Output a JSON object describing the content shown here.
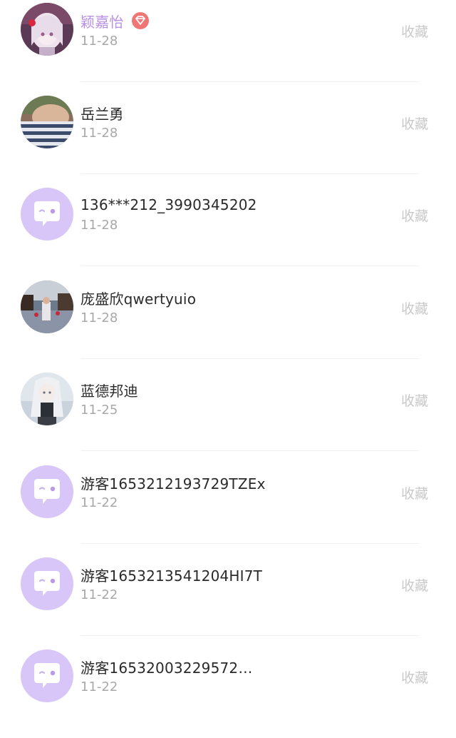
{
  "colors": {
    "vip_name": "#b890e6",
    "name": "#2a2a2a",
    "date": "#a8a8a8",
    "favorite": "#c9c9c9",
    "default_avatar_bg": "#d7c6f7",
    "vip_badge": "#f07575"
  },
  "comments": [
    {
      "name": "颖嘉怡",
      "date": "11-28",
      "favorite_label": "收藏",
      "vip": true,
      "avatar": "photo-avatar-anime-girl"
    },
    {
      "name": "岳兰勇",
      "date": "11-28",
      "favorite_label": "收藏",
      "vip": false,
      "avatar": "photo-avatar-baby"
    },
    {
      "name": "136***212_3990345202",
      "date": "11-28",
      "favorite_label": "收藏",
      "vip": false,
      "avatar": "default-chat-bubble-avatar"
    },
    {
      "name": "庞盛欣qwertyuio",
      "date": "11-28",
      "favorite_label": "收藏",
      "vip": false,
      "avatar": "photo-avatar-street"
    },
    {
      "name": "蓝德邦迪",
      "date": "11-25",
      "favorite_label": "收藏",
      "vip": false,
      "avatar": "photo-avatar-anime-white-hair"
    },
    {
      "name": "游客1653212193729TZEx",
      "date": "11-22",
      "favorite_label": "收藏",
      "vip": false,
      "avatar": "default-chat-bubble-avatar"
    },
    {
      "name": "游客1653213541204HI7T",
      "date": "11-22",
      "favorite_label": "收藏",
      "vip": false,
      "avatar": "default-chat-bubble-avatar"
    },
    {
      "name": "游客16532003229572…",
      "date": "11-22",
      "favorite_label": "收藏",
      "vip": false,
      "avatar": "default-chat-bubble-avatar"
    }
  ]
}
